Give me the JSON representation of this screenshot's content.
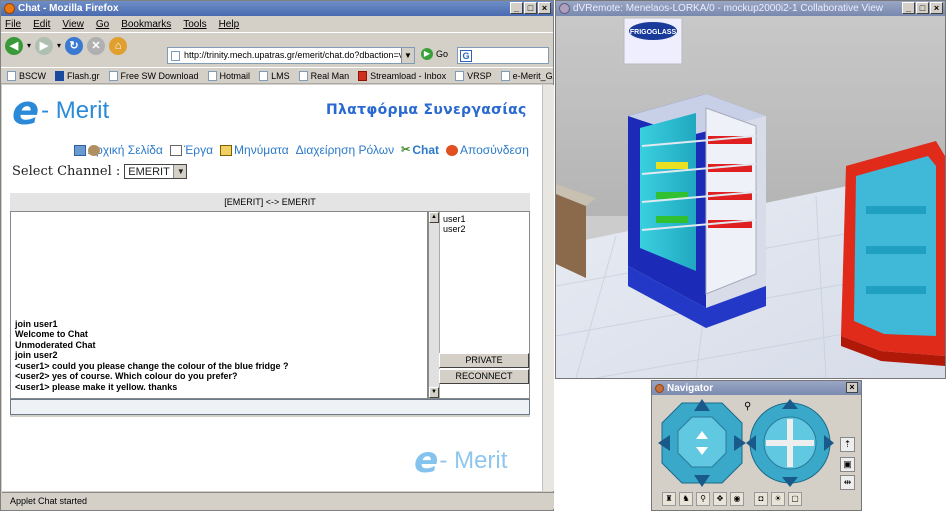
{
  "firefox": {
    "title": "Chat - Mozilla Firefox",
    "menu": [
      "File",
      "Edit",
      "View",
      "Go",
      "Bookmarks",
      "Tools",
      "Help"
    ],
    "url": "http://trinity.mech.upatras.gr/emerit/chat.do?dbaction=viei",
    "go_label": "Go",
    "bookmarks": [
      "BSCW",
      "Flash.gr",
      "Free SW Download",
      "Hotmail",
      "LMS",
      "Real Man",
      "Streamload - Inbox",
      "VRSP",
      "e-Merit_GAP"
    ],
    "bookmarks_more": "»",
    "status": "Applet Chat started"
  },
  "page": {
    "logo_e": "e",
    "logo_merit": "- Merit",
    "platform_title": "Πλατφόρμα Συνεργασίας",
    "nav": [
      {
        "label": "Αρχική Σελίδα",
        "icon": "home-icon"
      },
      {
        "label": "Έργα",
        "icon": "document-icon"
      },
      {
        "label": "Μηνύματα",
        "icon": "mail-icon"
      },
      {
        "label": "Διαχείρηση Ρόλων",
        "icon": "users-icon"
      },
      {
        "label": "Chat",
        "icon": "chat-icon"
      },
      {
        "label": "Αποσύνδεση",
        "icon": "logout-icon"
      }
    ],
    "select_channel_label": "Select Channel :",
    "select_channel_value": "EMERIT"
  },
  "chat": {
    "header": "[EMERIT] <-> EMERIT",
    "messages": [
      "join user1",
      "Welcome to Chat",
      "Unmoderated Chat",
      "join user2",
      "<user1> could you please change the colour of the blue fridge ?",
      "<user2> yes of course. Which colour do you prefer?",
      "<user1> please make it yellow. thanks"
    ],
    "users": [
      "user1",
      "user2"
    ],
    "private_label": "PRIVATE",
    "reconnect_label": "RECONNECT",
    "input_value": ""
  },
  "dvremote": {
    "title": "dVRemote: Menelaos-LORKA/0 - mockup2000i2-1 Collaborative View",
    "sign_text": "FRIGOGLASS"
  },
  "navigator": {
    "title": "Navigator"
  },
  "colors": {
    "brand": "#2a8ad8",
    "window_face": "#d4d0c8",
    "fridge_blue": "#2438c8",
    "fridge_red": "#e02a1a"
  }
}
